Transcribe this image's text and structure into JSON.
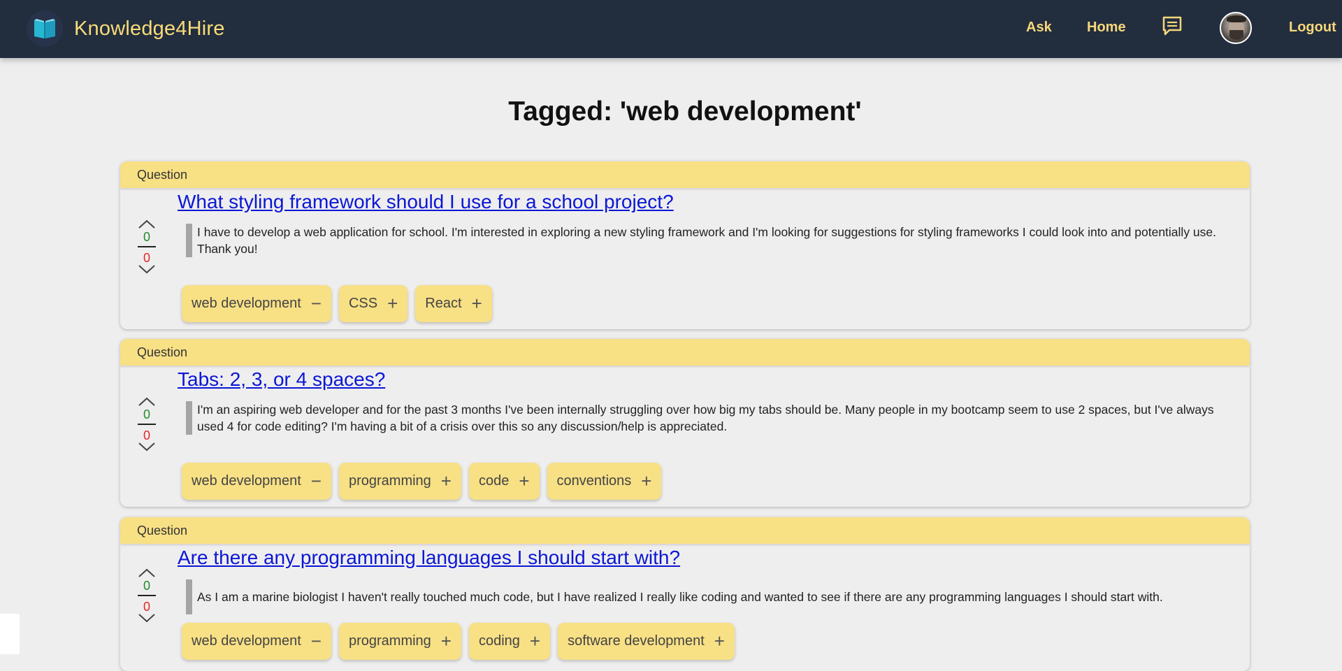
{
  "app": {
    "brand": "Knowledge4Hire"
  },
  "nav": {
    "ask": "Ask",
    "home": "Home",
    "logout": "Logout",
    "icons": [
      "book-logo-icon",
      "chat-icon",
      "user-avatar"
    ]
  },
  "page": {
    "title": "Tagged: 'web development'"
  },
  "questions": [
    {
      "label": "Question",
      "title": "What styling framework should I use for a school project?",
      "body": "I have to develop a web application for school. I'm interested in exploring a new styling framework and I'm looking for suggestions for styling frameworks I could look into and potentially use. Thank you!",
      "upvotes": "0",
      "downvotes": "0",
      "tags": [
        {
          "name": "web development",
          "action": "−"
        },
        {
          "name": "CSS",
          "action": "+"
        },
        {
          "name": "React",
          "action": "+"
        }
      ]
    },
    {
      "label": "Question",
      "title": "Tabs: 2, 3, or 4 spaces?",
      "body": "I'm an aspiring web developer and for the past 3 months I've been internally struggling over how big my tabs should be. Many people in my bootcamp seem to use 2 spaces, but I've always used 4 for code editing? I'm having a bit of a crisis over this so any discussion/help is appreciated.",
      "upvotes": "0",
      "downvotes": "0",
      "tags": [
        {
          "name": "web development",
          "action": "−"
        },
        {
          "name": "programming",
          "action": "+"
        },
        {
          "name": "code",
          "action": "+"
        },
        {
          "name": "conventions",
          "action": "+"
        }
      ]
    },
    {
      "label": "Question",
      "title": "Are there any programming languages I should start with?",
      "body": "As I am a marine biologist I haven't really touched much code, but I have realized I really like coding and wanted to see if there are any programming languages I should start with.",
      "upvotes": "0",
      "downvotes": "0",
      "tags": [
        {
          "name": "web development",
          "action": "−"
        },
        {
          "name": "programming",
          "action": "+"
        },
        {
          "name": "coding",
          "action": "+"
        },
        {
          "name": "software development",
          "action": "+"
        }
      ]
    }
  ],
  "colors": {
    "navbar": "#222d3e",
    "accent": "#f8e085",
    "link": "#0b17d6",
    "upvote": "#1f8a2a",
    "downvote": "#e02626"
  }
}
